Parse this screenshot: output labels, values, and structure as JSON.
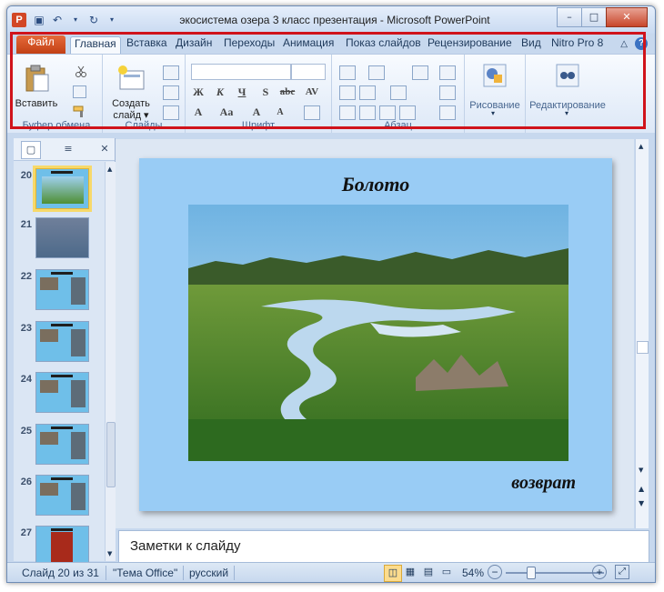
{
  "window": {
    "title": "экосистема озера 3 класс презентация  -  Microsoft PowerPoint",
    "app_icon": "P"
  },
  "quick_access": [
    "save-icon",
    "undo-icon",
    "redo-icon",
    "customize-icon"
  ],
  "ribbon_tabs": {
    "file": "Файл",
    "tabs": [
      "Главная",
      "Вставка",
      "Дизайн",
      "Переходы",
      "Анимация",
      "Показ слайдов",
      "Рецензирование",
      "Вид",
      "Nitro Pro 8"
    ],
    "active": "Главная",
    "help": "?"
  },
  "ribbon": {
    "clipboard": {
      "paste": "Вставить",
      "label": "Буфер обмена"
    },
    "slides": {
      "new_slide_line1": "Создать",
      "new_slide_line2": "слайд ▾",
      "label": "Слайды"
    },
    "font": {
      "bold": "Ж",
      "italic": "К",
      "underline": "Ч",
      "shadow": "S",
      "strike": "abc",
      "spacing": "AV",
      "size_up": "A",
      "size_down": "A",
      "case": "Aa",
      "color": "A",
      "label": "Шрифт"
    },
    "paragraph": {
      "label": "Абзац"
    },
    "drawing": {
      "label": "Рисование"
    },
    "editing": {
      "label": "Редактирование"
    }
  },
  "thumbnails": [
    {
      "num": "20",
      "selected": true
    },
    {
      "num": "21",
      "selected": false
    },
    {
      "num": "22",
      "selected": false
    },
    {
      "num": "23",
      "selected": false
    },
    {
      "num": "24",
      "selected": false
    },
    {
      "num": "25",
      "selected": false
    },
    {
      "num": "26",
      "selected": false
    },
    {
      "num": "27",
      "selected": false
    }
  ],
  "slide": {
    "title": "Болото",
    "link": "возврат",
    "background": "#99ccf5"
  },
  "notes": {
    "placeholder": "Заметки к слайду"
  },
  "status": {
    "slide_info": "Слайд 20 из 31",
    "theme": "\"Тема Office\"",
    "language": "русский",
    "zoom": "54%"
  },
  "colors": {
    "accent_red": "#d0131b",
    "file_tab": "#c24015"
  }
}
